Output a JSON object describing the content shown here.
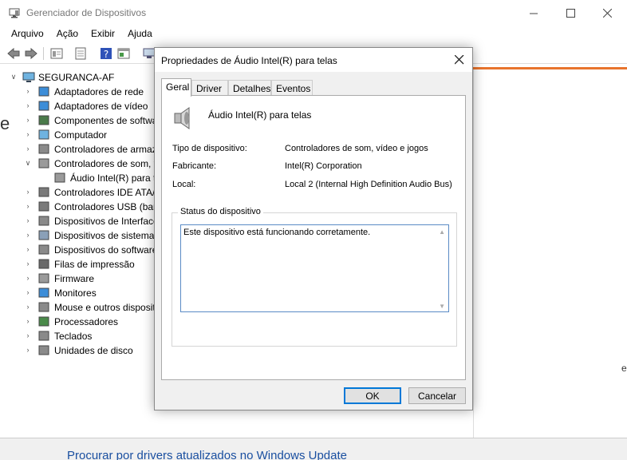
{
  "window": {
    "title": "Gerenciador de Dispositivos",
    "minimize_icon": "minimize-icon",
    "maximize_icon": "maximize-icon",
    "close_icon": "close-icon"
  },
  "menu": [
    "Arquivo",
    "Ação",
    "Exibir",
    "Ajuda"
  ],
  "tree": {
    "root": "SEGURANCA-AF",
    "items": [
      {
        "label": "Adaptadores de rede",
        "icon": "network-adapter-icon"
      },
      {
        "label": "Adaptadores de vídeo",
        "icon": "display-adapter-icon"
      },
      {
        "label": "Componentes de softwa",
        "icon": "software-component-icon"
      },
      {
        "label": "Computador",
        "icon": "computer-icon"
      },
      {
        "label": "Controladores de armaz",
        "icon": "storage-controller-icon"
      },
      {
        "label": "Controladores de som, v",
        "icon": "sound-icon",
        "expanded": true
      },
      {
        "label": "Áudio Intel(R) para t",
        "icon": "speaker-icon",
        "child": true
      },
      {
        "label": "Controladores IDE ATA/A",
        "icon": "ide-icon"
      },
      {
        "label": "Controladores USB (barr",
        "icon": "usb-icon"
      },
      {
        "label": "Dispositivos de Interface",
        "icon": "hid-icon"
      },
      {
        "label": "Dispositivos de sistema",
        "icon": "system-device-icon"
      },
      {
        "label": "Dispositivos do software",
        "icon": "software-device-icon"
      },
      {
        "label": "Filas de impressão",
        "icon": "printer-icon"
      },
      {
        "label": "Firmware",
        "icon": "firmware-icon"
      },
      {
        "label": "Monitores",
        "icon": "monitor-icon"
      },
      {
        "label": "Mouse e outros disposit",
        "icon": "mouse-icon"
      },
      {
        "label": "Processadores",
        "icon": "processor-icon"
      },
      {
        "label": "Teclados",
        "icon": "keyboard-icon"
      },
      {
        "label": "Unidades de disco",
        "icon": "disk-drive-icon"
      }
    ]
  },
  "background": {
    "bottom_link": "Procurar por drivers atualizados no Windows Update",
    "edge_letter_left": "e",
    "edge_letter_right": "e"
  },
  "dialog": {
    "title": "Propriedades de Áudio Intel(R) para telas",
    "tabs": [
      "Geral",
      "Driver",
      "Detalhes",
      "Eventos"
    ],
    "active_tab": "Geral",
    "device_name": "Áudio Intel(R) para telas",
    "properties": [
      {
        "label": "Tipo de dispositivo:",
        "value": "Controladores de som, vídeo e jogos"
      },
      {
        "label": "Fabricante:",
        "value": "Intel(R) Corporation"
      },
      {
        "label": "Local:",
        "value": "Local 2 (Internal High Definition Audio Bus)"
      }
    ],
    "status_group": "Status do dispositivo",
    "status_text": "Este dispositivo está funcionando corretamente.",
    "ok": "OK",
    "cancel": "Cancelar"
  }
}
